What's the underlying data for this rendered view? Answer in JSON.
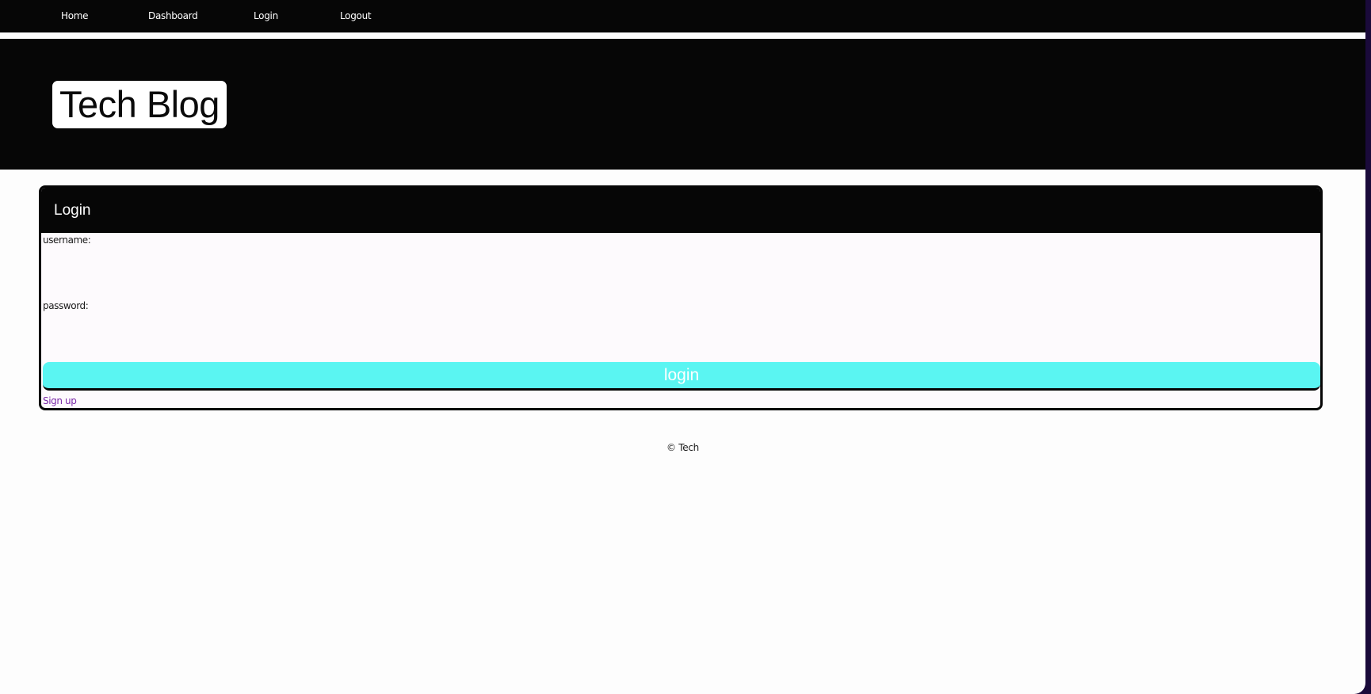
{
  "nav": {
    "items": [
      {
        "label": "Home"
      },
      {
        "label": "Dashboard"
      },
      {
        "label": "Login"
      },
      {
        "label": "Logout"
      }
    ]
  },
  "header": {
    "title": "Tech Blog"
  },
  "login_card": {
    "title": "Login",
    "username_label": "username:",
    "username_value": "",
    "password_label": "password:",
    "password_value": "",
    "submit_label": "login",
    "signup_label": "Sign up"
  },
  "footer": {
    "text": "© Tech"
  },
  "colors": {
    "nav_background": "#060606",
    "button_accent": "#5af5f2",
    "link_color": "#7b2aa8"
  }
}
